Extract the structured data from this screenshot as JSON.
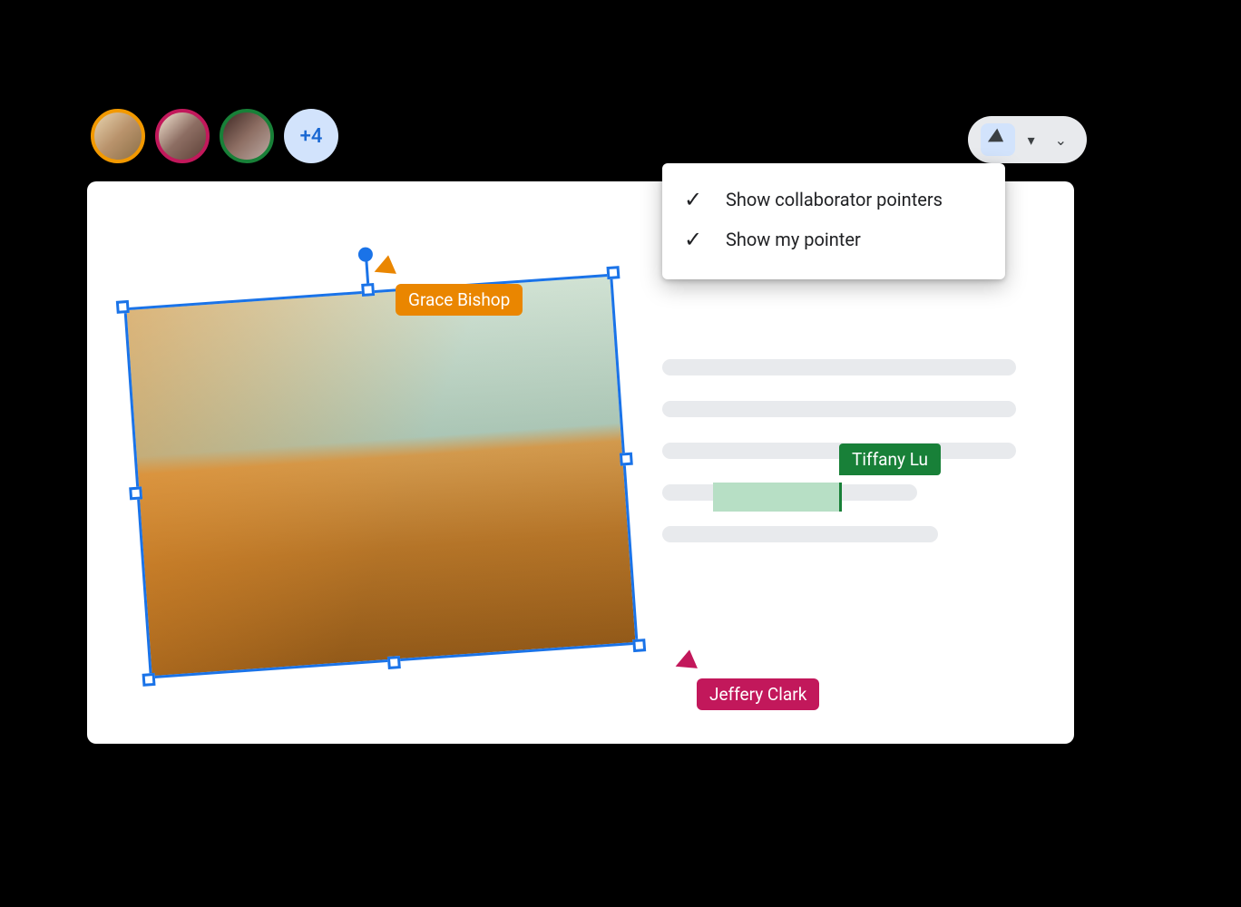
{
  "collaborators": {
    "additional_count_label": "+4",
    "avatars": [
      {
        "ring_color": "#f29900"
      },
      {
        "ring_color": "#c2185b"
      },
      {
        "ring_color": "#188038"
      }
    ],
    "cursors": {
      "grace": {
        "name": "Grace Bishop",
        "color": "#ea8600"
      },
      "jeffery": {
        "name": "Jeffery Clark",
        "color": "#c2185b"
      },
      "tiffany": {
        "name": "Tiffany Lu",
        "color": "#188038"
      }
    }
  },
  "pointer_menu": {
    "item1": "Show collaborator pointers",
    "item2": "Show my pointer",
    "item1_checked": true,
    "item2_checked": true
  }
}
